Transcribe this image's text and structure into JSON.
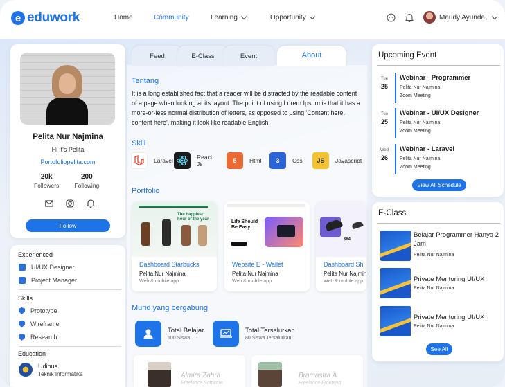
{
  "header": {
    "logo_mark": "e",
    "logo_text": "eduwork",
    "nav": [
      {
        "label": "Home"
      },
      {
        "label": "Community"
      },
      {
        "label": "Learning"
      },
      {
        "label": "Opportunity"
      }
    ],
    "user_name": "Maudy Ayunda"
  },
  "profile": {
    "name": "Pelita Nur Najmina",
    "bio": "Hi it's Pelita",
    "link": "Portofoliopelita.com",
    "followers_count": "20k",
    "followers_label": "Followers",
    "following_count": "200",
    "following_label": "Following",
    "follow_label": "Follow"
  },
  "sidebar": {
    "experienced_title": "Experienced",
    "experienced": [
      "UI/UX Designer",
      "Project Manager"
    ],
    "skills_title": "Skills",
    "skills": [
      "Prototype",
      "Wireframe",
      "Research"
    ],
    "education_title": "Education",
    "school": "Udinus",
    "major": "Teknik Informatika"
  },
  "tabs": [
    "Feed",
    "E-Class",
    "Event",
    "About"
  ],
  "about": {
    "tentang_title": "Tentang",
    "tentang_text": "It is a long established fact that a reader will be distracted by the readable content of a page when looking at its layout. The point of using Lorem Ipsum is that it has a more-or-less normal distribution of letters, as opposed to using 'Content here, content here', making it look like readable English.",
    "skill_title": "Skill",
    "skills": [
      {
        "label": "Laravel",
        "color": "#e8412e"
      },
      {
        "label": "React Js",
        "color": "#1b1b1b"
      },
      {
        "label": "Html",
        "color": "#ec6a34"
      },
      {
        "label": "Css",
        "color": "#2a64d8"
      },
      {
        "label": "Javascript",
        "color": "#f2c230"
      }
    ],
    "portfolio_title": "Portfolio",
    "portfolio": [
      {
        "title": "Dashboard Starbucks",
        "owner": "Pelita Nur Najmina",
        "type": "Web & mobile app",
        "thumb_text": "The happiest hour of the year"
      },
      {
        "title": "Website E - Wallet",
        "owner": "Pelita Nur Najmina",
        "type": "Web & mobile app",
        "thumb_text": "Life Should Be Easy."
      },
      {
        "title": "Dashboard Sh",
        "owner": "Pelita Nur Najmina",
        "type": "Web & mobile app",
        "thumb_text": "$84"
      }
    ],
    "members_title": "Murid yang bergabung",
    "total_belajar": {
      "title": "Total Belajar",
      "sub": "100 Siswa"
    },
    "total_tersalurkan": {
      "title": "Total Tersalurkan",
      "sub": "80 Siswa Tersalurkan"
    },
    "members": [
      {
        "name": "Almira Zahra",
        "role": "Freelance Software"
      },
      {
        "name": "Bramastra A",
        "role": "Freelance Frontend"
      }
    ]
  },
  "events": {
    "title": "Upcoming Event",
    "items": [
      {
        "dow": "Tue",
        "day": "25",
        "title": "Webinar - Programmer",
        "who": "Pelita Nur Najmina",
        "where": "Zoom Meeting"
      },
      {
        "dow": "Tue",
        "day": "25",
        "title": "Webinar - UI/UX Designer",
        "who": "Pelita Nur Najmina",
        "where": "Zoom Meeting"
      },
      {
        "dow": "Wed",
        "day": "26",
        "title": "Webinar - Laravel",
        "who": "Pelita Nur Najmina",
        "where": "Zoom Meeting"
      }
    ],
    "button": "View All Schedule"
  },
  "eclass": {
    "title": "E-Class",
    "items": [
      {
        "title": "Belajar Programmer Hanya 2 Jam",
        "who": "Pelita Nur Najmina"
      },
      {
        "title": "Private Mentoring UI/UX",
        "who": "Pelita Nur Najmina"
      },
      {
        "title": "Private Mentoring UI/UX",
        "who": "Pelita Nur Najmina"
      }
    ],
    "button": "See All"
  },
  "colors": {
    "accent": "#1e73e8"
  }
}
